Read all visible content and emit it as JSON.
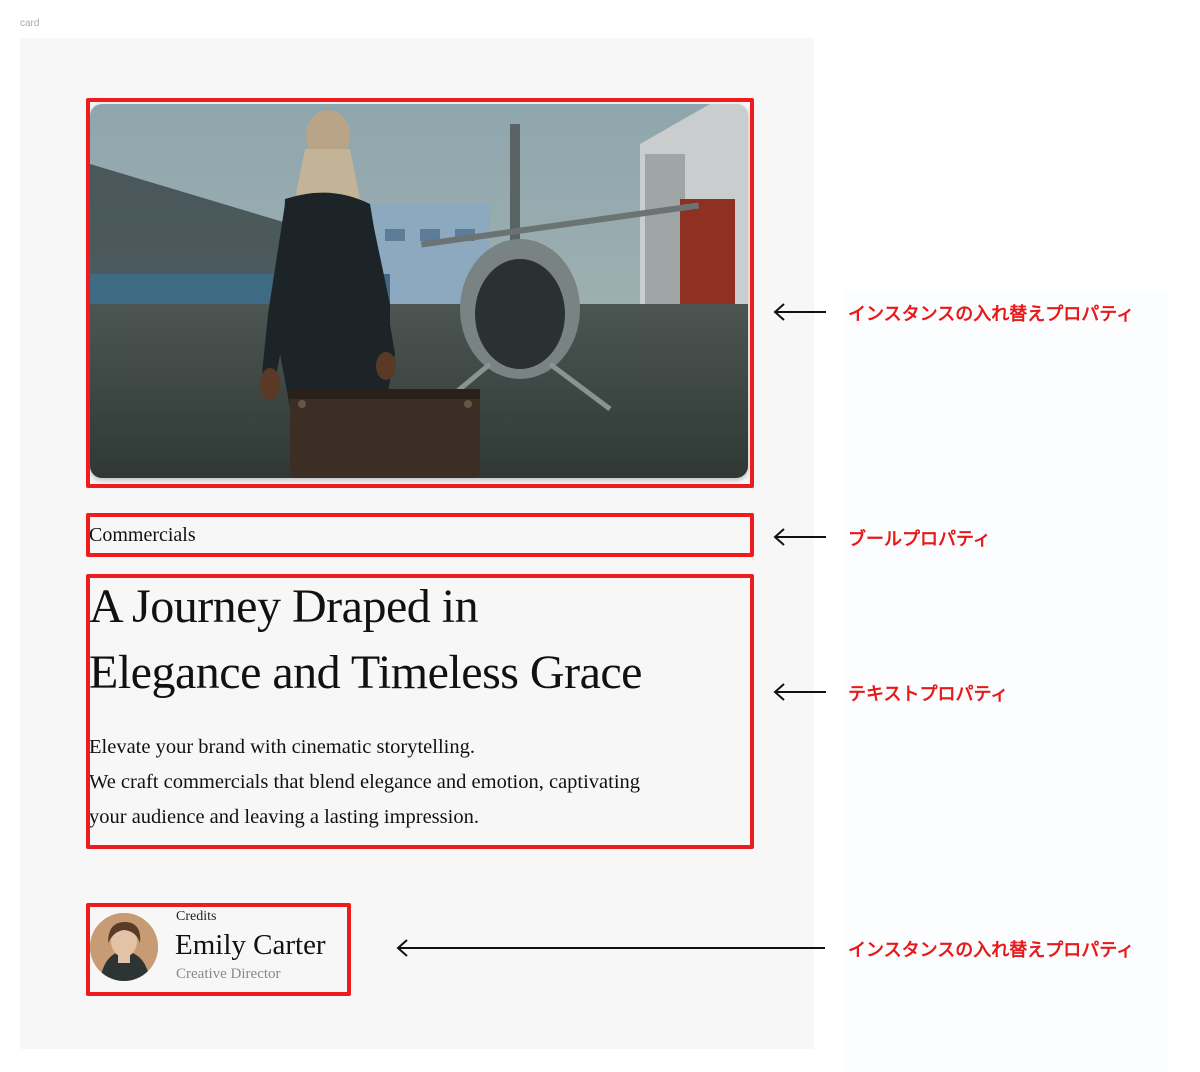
{
  "frame_label": "card",
  "card": {
    "category": "Commercials",
    "headline": [
      "A Journey Draped in",
      "Elegance and Timeless Grace"
    ],
    "body": [
      "Elevate your brand with cinematic storytelling.",
      "We craft commercials that blend elegance and emotion, captivating",
      "your audience and leaving a lasting impression."
    ],
    "credits": {
      "label": "Credits",
      "name": "Emily Carter",
      "role": "Creative Director"
    }
  },
  "annotations": {
    "image": "インスタンスの入れ替えプロパティ",
    "category": "ブールプロパティ",
    "text": "テキストプロパティ",
    "credits": "インスタンスの入れ替えプロパティ"
  },
  "colors": {
    "annotation_red": "#ee1c1c",
    "card_bg": "#f7f7f7"
  },
  "icons": {
    "annotation_arrow": "arrow-left-icon"
  }
}
